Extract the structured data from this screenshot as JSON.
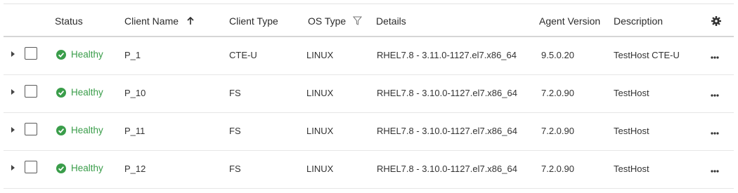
{
  "columns": {
    "status": "Status",
    "client_name": "Client Name",
    "client_type": "Client Type",
    "os_type": "OS Type",
    "details": "Details",
    "agent_version": "Agent Version",
    "description": "Description"
  },
  "colors": {
    "healthy": "#3a9d4a",
    "client_link": "#7a8a1a"
  },
  "rows": [
    {
      "status": "Healthy",
      "client_name": "P_1",
      "client_type": "CTE-U",
      "os_type": "LINUX",
      "details": "RHEL7.8 - 3.11.0-1127.el7.x86_64",
      "agent_version": "9.5.0.20",
      "description": "TestHost CTE-U"
    },
    {
      "status": "Healthy",
      "client_name": "P_10",
      "client_type": "FS",
      "os_type": "LINUX",
      "details": "RHEL7.8 - 3.10.0-1127.el7.x86_64",
      "agent_version": "7.2.0.90",
      "description": "TestHost"
    },
    {
      "status": "Healthy",
      "client_name": "P_11",
      "client_type": "FS",
      "os_type": "LINUX",
      "details": "RHEL7.8 - 3.10.0-1127.el7.x86_64",
      "agent_version": "7.2.0.90",
      "description": "TestHost"
    },
    {
      "status": "Healthy",
      "client_name": "P_12",
      "client_type": "FS",
      "os_type": "LINUX",
      "details": "RHEL7.8 - 3.10.0-1127.el7.x86_64",
      "agent_version": "7.2.0.90",
      "description": "TestHost"
    }
  ]
}
